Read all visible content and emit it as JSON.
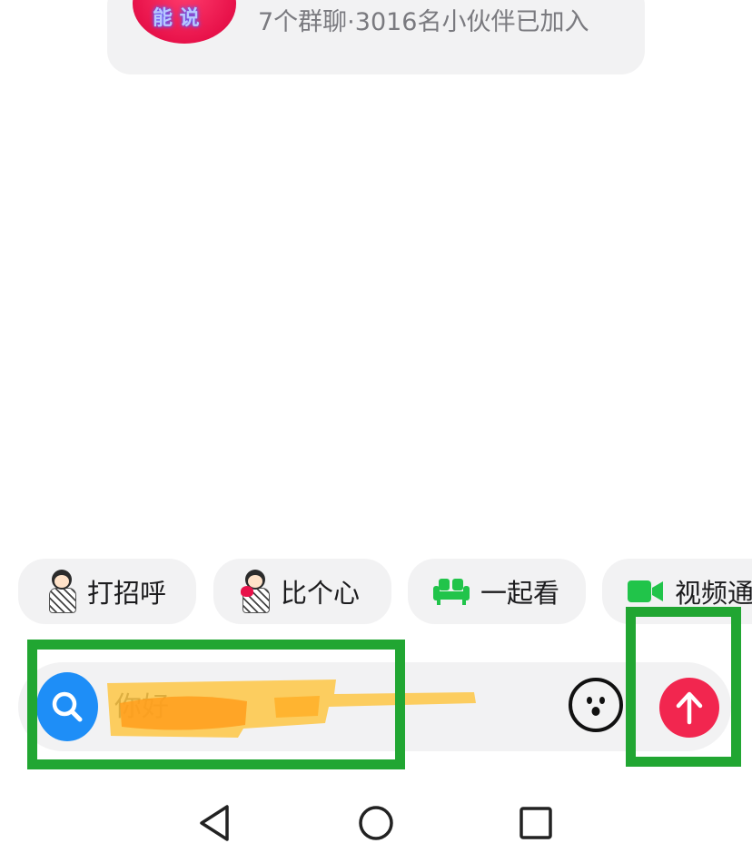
{
  "group": {
    "avatar_text": "能 说",
    "info": "7个群聊·3016名小伙伴已加入"
  },
  "quick_actions": [
    {
      "label": "打招呼",
      "icon": "waving-sticker-icon"
    },
    {
      "label": "比个心",
      "icon": "heart-sticker-icon"
    },
    {
      "label": "一起看",
      "icon": "sofa-icon"
    },
    {
      "label": "视频通",
      "icon": "video-camera-icon"
    }
  ],
  "input": {
    "placeholder": "你好"
  },
  "colors": {
    "accent_green": "#21c44a",
    "highlight_green": "#21a632",
    "search_blue": "#1e8ef7",
    "send_red": "#f2264f"
  }
}
